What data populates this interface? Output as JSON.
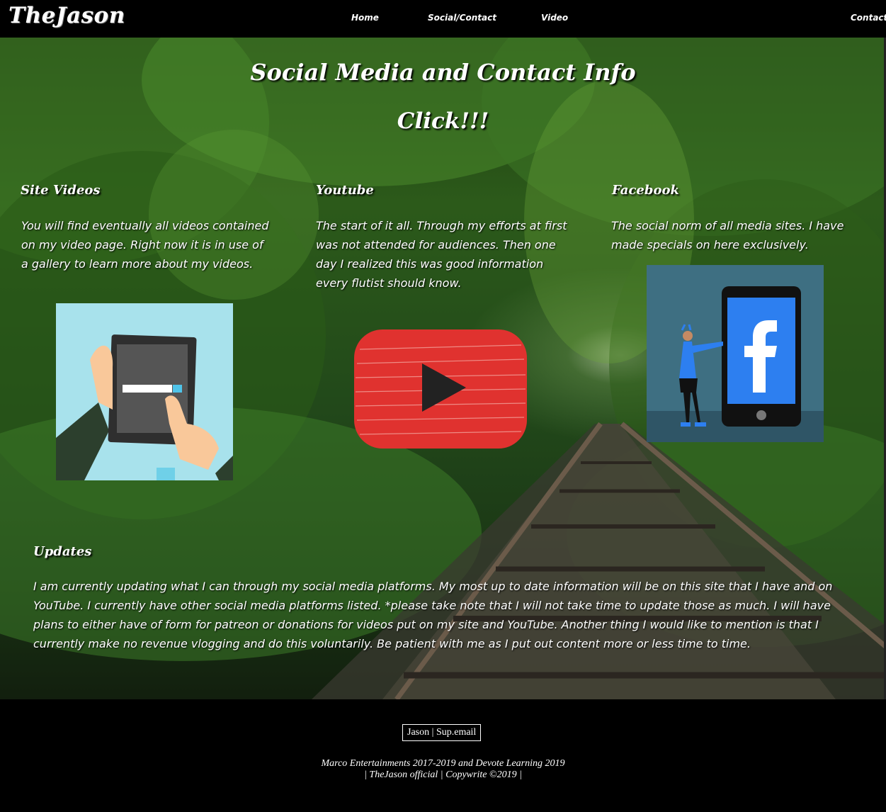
{
  "nav": {
    "brand": "TheJason",
    "links": [
      "Home",
      "Social/Contact",
      "Video",
      "Contact"
    ]
  },
  "hero": {
    "title": "Social Media and Contact Info",
    "click": "Click!!!"
  },
  "columns": [
    {
      "heading": "Site Videos",
      "text": "You will find eventually all videos contained on my video page. Right now it is in use of a gallery to learn more about my videos.",
      "image_icon": "tablet-search-icon"
    },
    {
      "heading": "Youtube",
      "text": "The start of it all. Through my efforts at first was not attended for audiences. Then one day I realized this was good information every flutist should know.",
      "image_icon": "youtube-play-icon"
    },
    {
      "heading": "Facebook",
      "text": "The social norm of all media sites. I have made specials on here exclusively.",
      "image_icon": "facebook-phone-icon"
    }
  ],
  "updates": {
    "heading": "Updates",
    "text": "I am currently updating what I can through my social media platforms. My most up to date information will be on this site that I have and on YouTube. I currently have other social media platforms listed. *please take note that I will not take time to update those as much. I will have plans to either have of form for patreon or donations for videos put on my site and YouTube. Another thing I would like to mention is that I currently make no revenue vlogging and do this voluntarily. Be patient with me as I put out content more or less time to time."
  },
  "footer": {
    "contact_name": "Jason",
    "contact_sep": " | ",
    "contact_email": "Sup.email",
    "credit_line1": "Marco Entertainments 2017-2019 and Devote Learning 2019",
    "credit_line2": "| TheJason official | Copywrite ©2019 |"
  },
  "colors": {
    "youtube_red": "#e0322f",
    "facebook_blue": "#2d7ff0",
    "tablet_bg": "#a8e2ec",
    "fb_bg": "#3e6f82"
  }
}
